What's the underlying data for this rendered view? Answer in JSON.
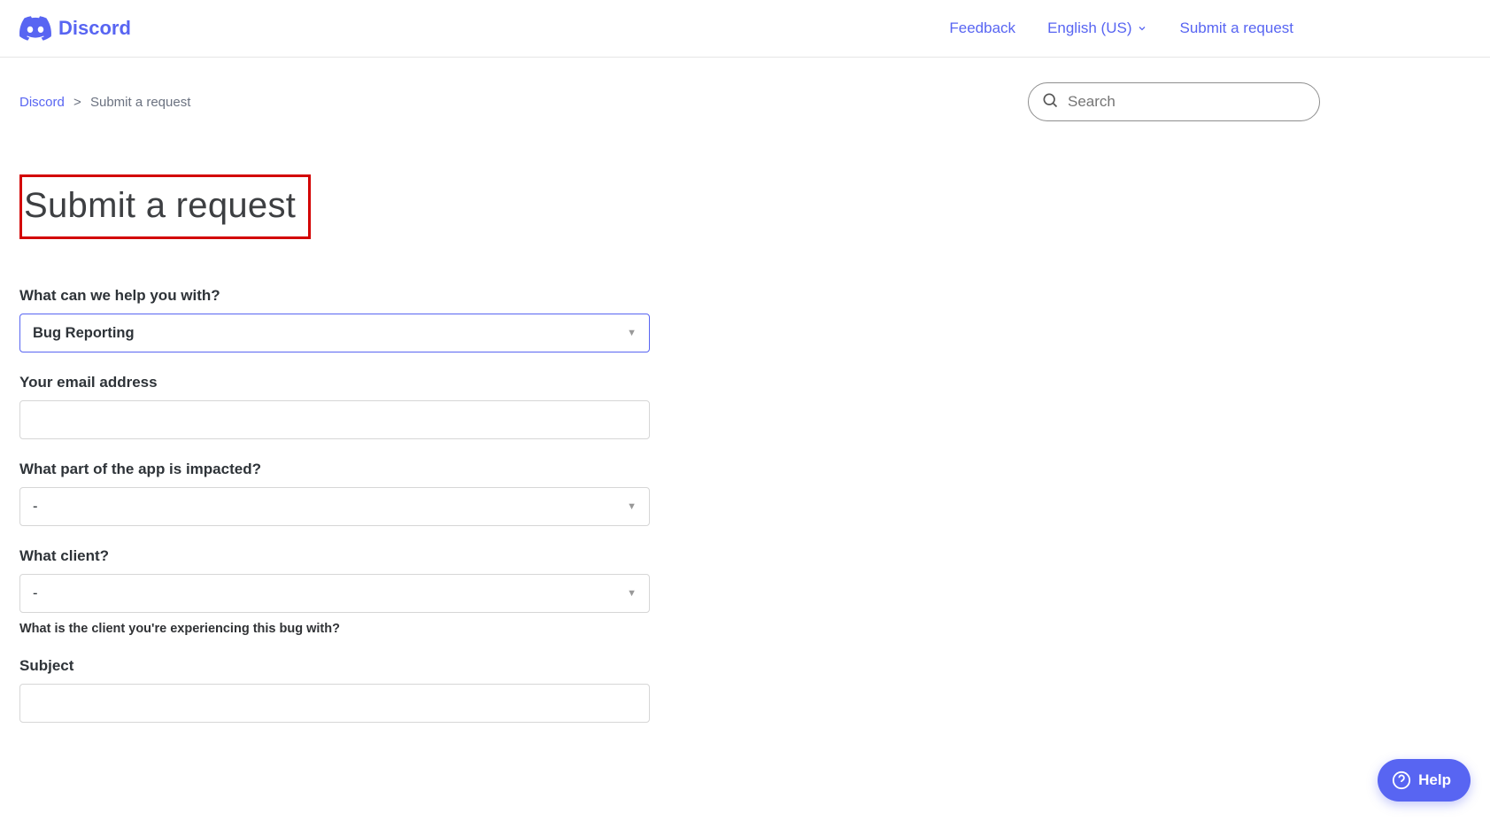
{
  "header": {
    "brand": "Discord",
    "nav": {
      "feedback": "Feedback",
      "language": "English (US)",
      "submit": "Submit a request"
    }
  },
  "breadcrumb": {
    "root": "Discord",
    "sep": ">",
    "current": "Submit a request"
  },
  "search": {
    "placeholder": "Search"
  },
  "page": {
    "title": "Submit a request"
  },
  "form": {
    "help_topic": {
      "label": "What can we help you with?",
      "value": "Bug Reporting"
    },
    "email": {
      "label": "Your email address",
      "value": ""
    },
    "impacted": {
      "label": "What part of the app is impacted?",
      "value": "-"
    },
    "client": {
      "label": "What client?",
      "value": "-",
      "hint": "What is the client you're experiencing this bug with?"
    },
    "subject": {
      "label": "Subject",
      "value": ""
    }
  },
  "helpButton": {
    "label": "Help"
  }
}
